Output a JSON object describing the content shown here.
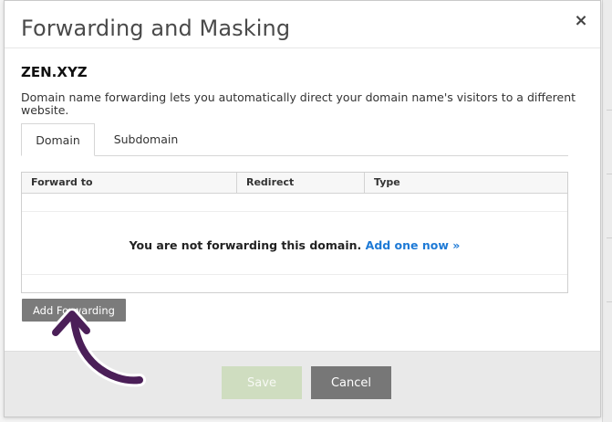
{
  "dialog": {
    "title": "Forwarding and Masking",
    "close_glyph": "×"
  },
  "domain": {
    "name": "ZEN.XYZ",
    "description": "Domain name forwarding lets you automatically direct your domain name's visitors to a different website."
  },
  "tabs": [
    {
      "label": "Domain",
      "active": true
    },
    {
      "label": "Subdomain",
      "active": false
    }
  ],
  "table": {
    "columns": [
      "Forward to",
      "Redirect",
      "Type"
    ],
    "empty_message": "You are not forwarding this domain.",
    "empty_link": "Add one now »"
  },
  "actions": {
    "add_forwarding": "Add Forwarding",
    "save": "Save",
    "cancel": "Cancel"
  },
  "colors": {
    "link": "#1e7ad6",
    "annotation_arrow": "#4b1f58",
    "save_disabled": "#cfddc0",
    "button_gray": "#777777"
  },
  "icons": {
    "close": "close-icon",
    "annotation": "curved-arrow-icon"
  }
}
